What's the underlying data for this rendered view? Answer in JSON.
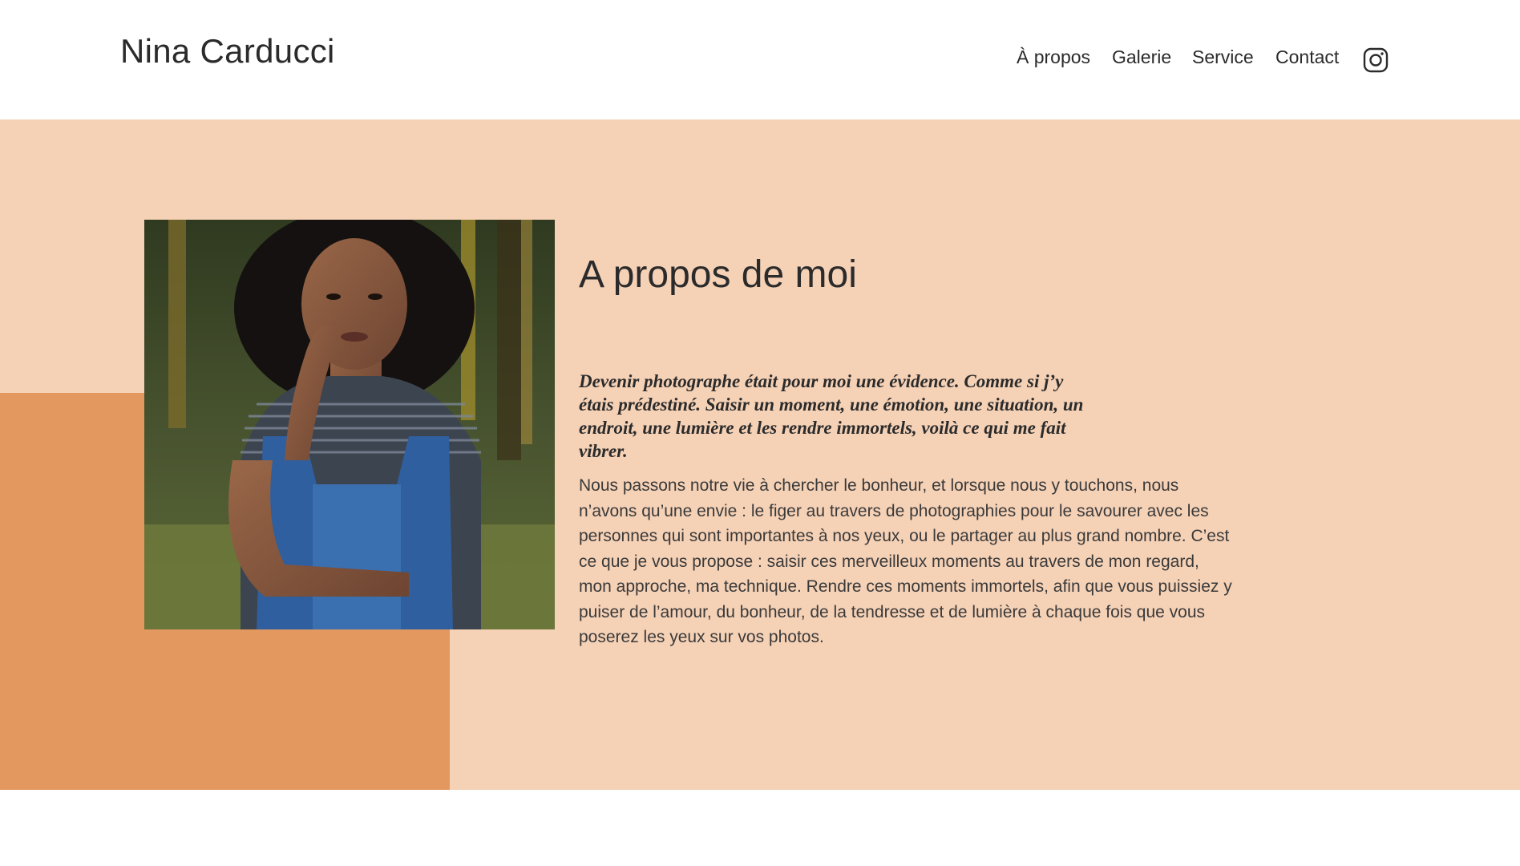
{
  "header": {
    "brand": "Nina Carducci",
    "nav": [
      {
        "label": "À propos"
      },
      {
        "label": "Galerie"
      },
      {
        "label": "Service"
      },
      {
        "label": "Contact"
      }
    ],
    "social_icon": "instagram-icon"
  },
  "about": {
    "title": "A propos de moi",
    "quote": "Devenir photographe était pour moi une évidence. Comme si j’y étais prédestiné. Saisir un moment, une émotion, une situation, un endroit, une lumière et les rendre immortels, voilà ce qui me fait vibrer.",
    "body": "Nous passons notre vie à chercher le bonheur, et lorsque nous y touchons, nous n’avons qu’une envie : le figer au travers de photographies pour le savourer avec les personnes qui sont importantes à nos yeux, ou le partager au plus grand nombre. C’est ce que je vous propose : saisir ces merveilleux moments au travers de mon regard, mon approche, ma technique. Rendre ces moments immortels, afin que vous puissiez y puiser de l’amour, du bonheur, de la tendresse et de lumière à chaque fois que vous poserez les yeux sur vos photos."
  },
  "colors": {
    "section_bg": "#f5d1b6",
    "accent_block": "#e3985f",
    "text": "#2b2b2b"
  }
}
